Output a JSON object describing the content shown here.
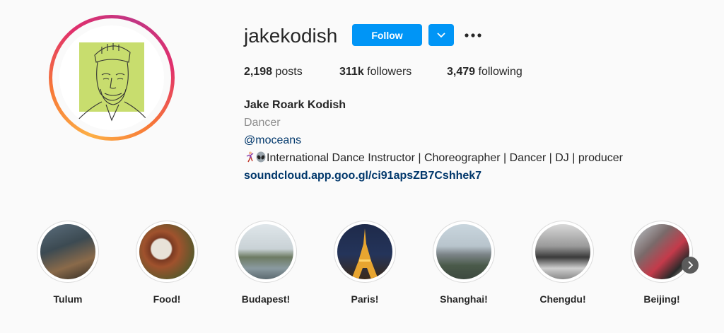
{
  "profile": {
    "username": "jakekodish",
    "follow_label": "Follow",
    "more_icon": "more-horizontal-icon",
    "dropdown_icon": "chevron-down-icon",
    "avatar_bg": "#c8dd6e"
  },
  "stats": {
    "posts_count": "2,198",
    "posts_label": "posts",
    "followers_count": "311k",
    "followers_label": "followers",
    "following_count": "3,479",
    "following_label": "following"
  },
  "bio": {
    "full_name": "Jake Roark Kodish",
    "category": "Dancer",
    "mention": "@moceans",
    "description": "International Dance Instructor | Choreographer | Dancer | DJ | producer",
    "link": "soundcloud.app.goo.gl/ci91apsZB7Cshhek7"
  },
  "highlights": [
    {
      "label": "Tulum"
    },
    {
      "label": "Food!"
    },
    {
      "label": "Budapest!"
    },
    {
      "label": "Paris!"
    },
    {
      "label": "Shanghai!"
    },
    {
      "label": "Chengdu!"
    },
    {
      "label": "Beijing!"
    }
  ],
  "colors": {
    "accent": "#0095f6",
    "link": "#00376b",
    "muted": "#8e8e8e"
  }
}
